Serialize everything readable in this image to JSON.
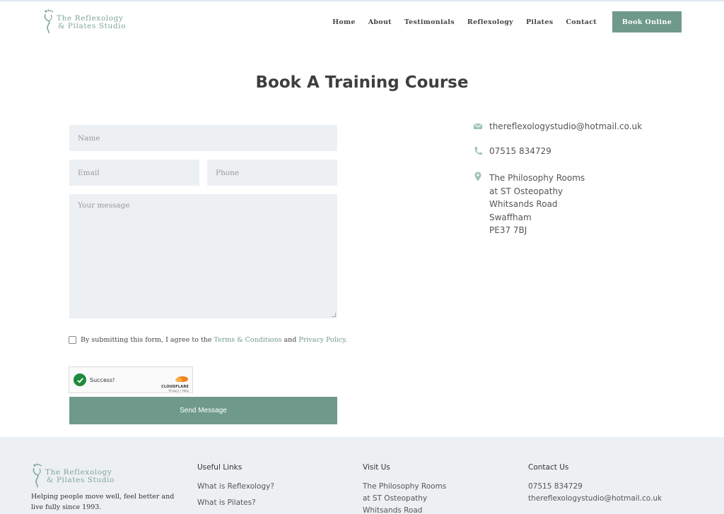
{
  "brand": {
    "logo_line1": "The Reflexology",
    "logo_line2": "& Pilates Studio",
    "accent_color": "#6f9a8b",
    "logo_icon": "foot-figure-icon"
  },
  "nav": {
    "items": [
      "Home",
      "About",
      "Testimonials",
      "Reflexology",
      "Pilates",
      "Contact"
    ],
    "book_label": "Book Online"
  },
  "page": {
    "title": "Book A Training Course"
  },
  "form": {
    "name_placeholder": "Name",
    "email_placeholder": "Email",
    "phone_placeholder": "Phone",
    "message_placeholder": "Your message",
    "consent_prefix": "By submitting this form, I agree to the",
    "consent_terms": "Terms & Conditions",
    "consent_and": "and",
    "consent_privacy": "Privacy Policy.",
    "captcha_status": "Success!",
    "captcha_brand": "CLOUDFLARE",
    "captcha_links": "Privacy • Help",
    "submit_label": "Send Message"
  },
  "contact": {
    "email": "thereflexologystudio@hotmail.co.uk",
    "phone": "07515 834729",
    "address": [
      "The Philosophy Rooms",
      "at ST Osteopathy",
      "Whitsands Road",
      "Swaffham",
      "PE37 7BJ"
    ]
  },
  "footer": {
    "tagline": "Helping people move well, feel better and live fully since 1993.",
    "useful_links_title": "Useful Links",
    "useful_links": [
      "What is Reflexology?",
      "What is Pilates?"
    ],
    "visit_title": "Visit Us",
    "visit_lines": [
      "The Philosophy Rooms",
      "at ST Osteopathy",
      "Whitsands Road"
    ],
    "contact_title": "Contact Us",
    "contact_phone": "07515 834729",
    "contact_email": "thereflexologystudio@hotmail.co.uk"
  }
}
